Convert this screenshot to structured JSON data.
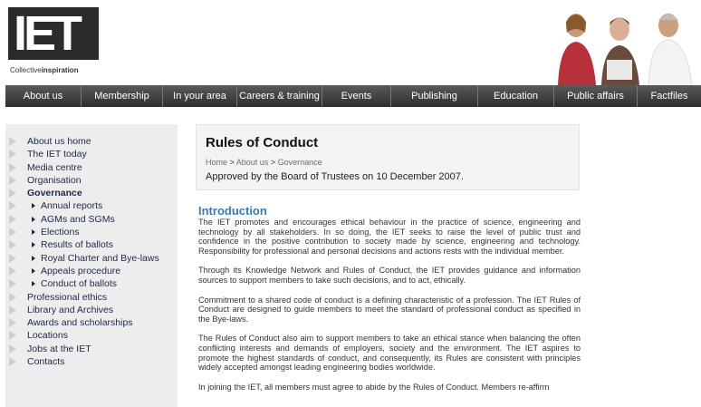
{
  "header": {
    "logo_letters": "IET",
    "logo_tagline_light": "Collective",
    "logo_tagline_bold": "inspiration"
  },
  "nav": {
    "items": [
      {
        "label": "About us"
      },
      {
        "label": "Membership"
      },
      {
        "label": "In your area"
      },
      {
        "label": "Careers & training"
      },
      {
        "label": "Events"
      },
      {
        "label": "Publishing"
      },
      {
        "label": "Education"
      },
      {
        "label": "Public affairs"
      },
      {
        "label": "Factfiles"
      }
    ]
  },
  "sidebar": {
    "items": [
      {
        "label": "About us home"
      },
      {
        "label": "The IET today"
      },
      {
        "label": "Media centre"
      },
      {
        "label": "Organisation"
      },
      {
        "label": "Governance"
      }
    ],
    "sub_items": [
      {
        "label": "Annual reports"
      },
      {
        "label": "AGMs and SGMs"
      },
      {
        "label": "Elections"
      },
      {
        "label": "Results of ballots"
      },
      {
        "label": "Royal Charter and Bye-laws"
      },
      {
        "label": "Appeals procedure"
      },
      {
        "label": "Conduct of ballots"
      }
    ],
    "more_items": [
      {
        "label": "Professional ethics"
      },
      {
        "label": "Library and Archives"
      },
      {
        "label": "Awards and scholarships"
      },
      {
        "label": "Locations"
      },
      {
        "label": "Jobs at the IET"
      },
      {
        "label": "Contacts"
      }
    ]
  },
  "main": {
    "title": "Rules of Conduct",
    "breadcrumb": {
      "home": "Home",
      "sep1": " > ",
      "about": "About us",
      "sep2": " > ",
      "current": "Governance"
    },
    "approved": "Approved by the Board of Trustees on 10 December 2007.",
    "section_heading": "Introduction",
    "paragraphs": [
      "The IET promotes and encourages ethical behaviour in the practice of science, engineering and technology by all stakeholders.  In so doing, the IET seeks to raise the level of public trust and confidence in the positive contribution to society made by science, engineering and technology.  Responsibility for professional and personal decisions and actions rests with the individual member.",
      "Through its Knowledge Network and Rules of Conduct, the IET provides guidance and information sources to support members to take such decisions, and to act, ethically.",
      "Commitment to a shared code of conduct is a defining characteristic of a profession.  The IET Rules of Conduct are designed to guide members to meet the standard of professional conduct as specified in the Bye-laws.",
      "The Rules of Conduct also aim to support members to take an ethical stance when balancing the often conflicting interests and demands of employers, society and the environment.  The IET aspires to promote the highest standards of conduct, and consequently, its Rules are consistent with principles widely accepted amongst leading engineering bodies worldwide.",
      "In joining the IET, all members must agree to abide by the Rules of Conduct. Members re-affirm"
    ]
  },
  "colors": {
    "nav_bg": "#3f3f3f",
    "heading_blue": "#3a7ab8",
    "sidebar_bg": "#ededed"
  }
}
